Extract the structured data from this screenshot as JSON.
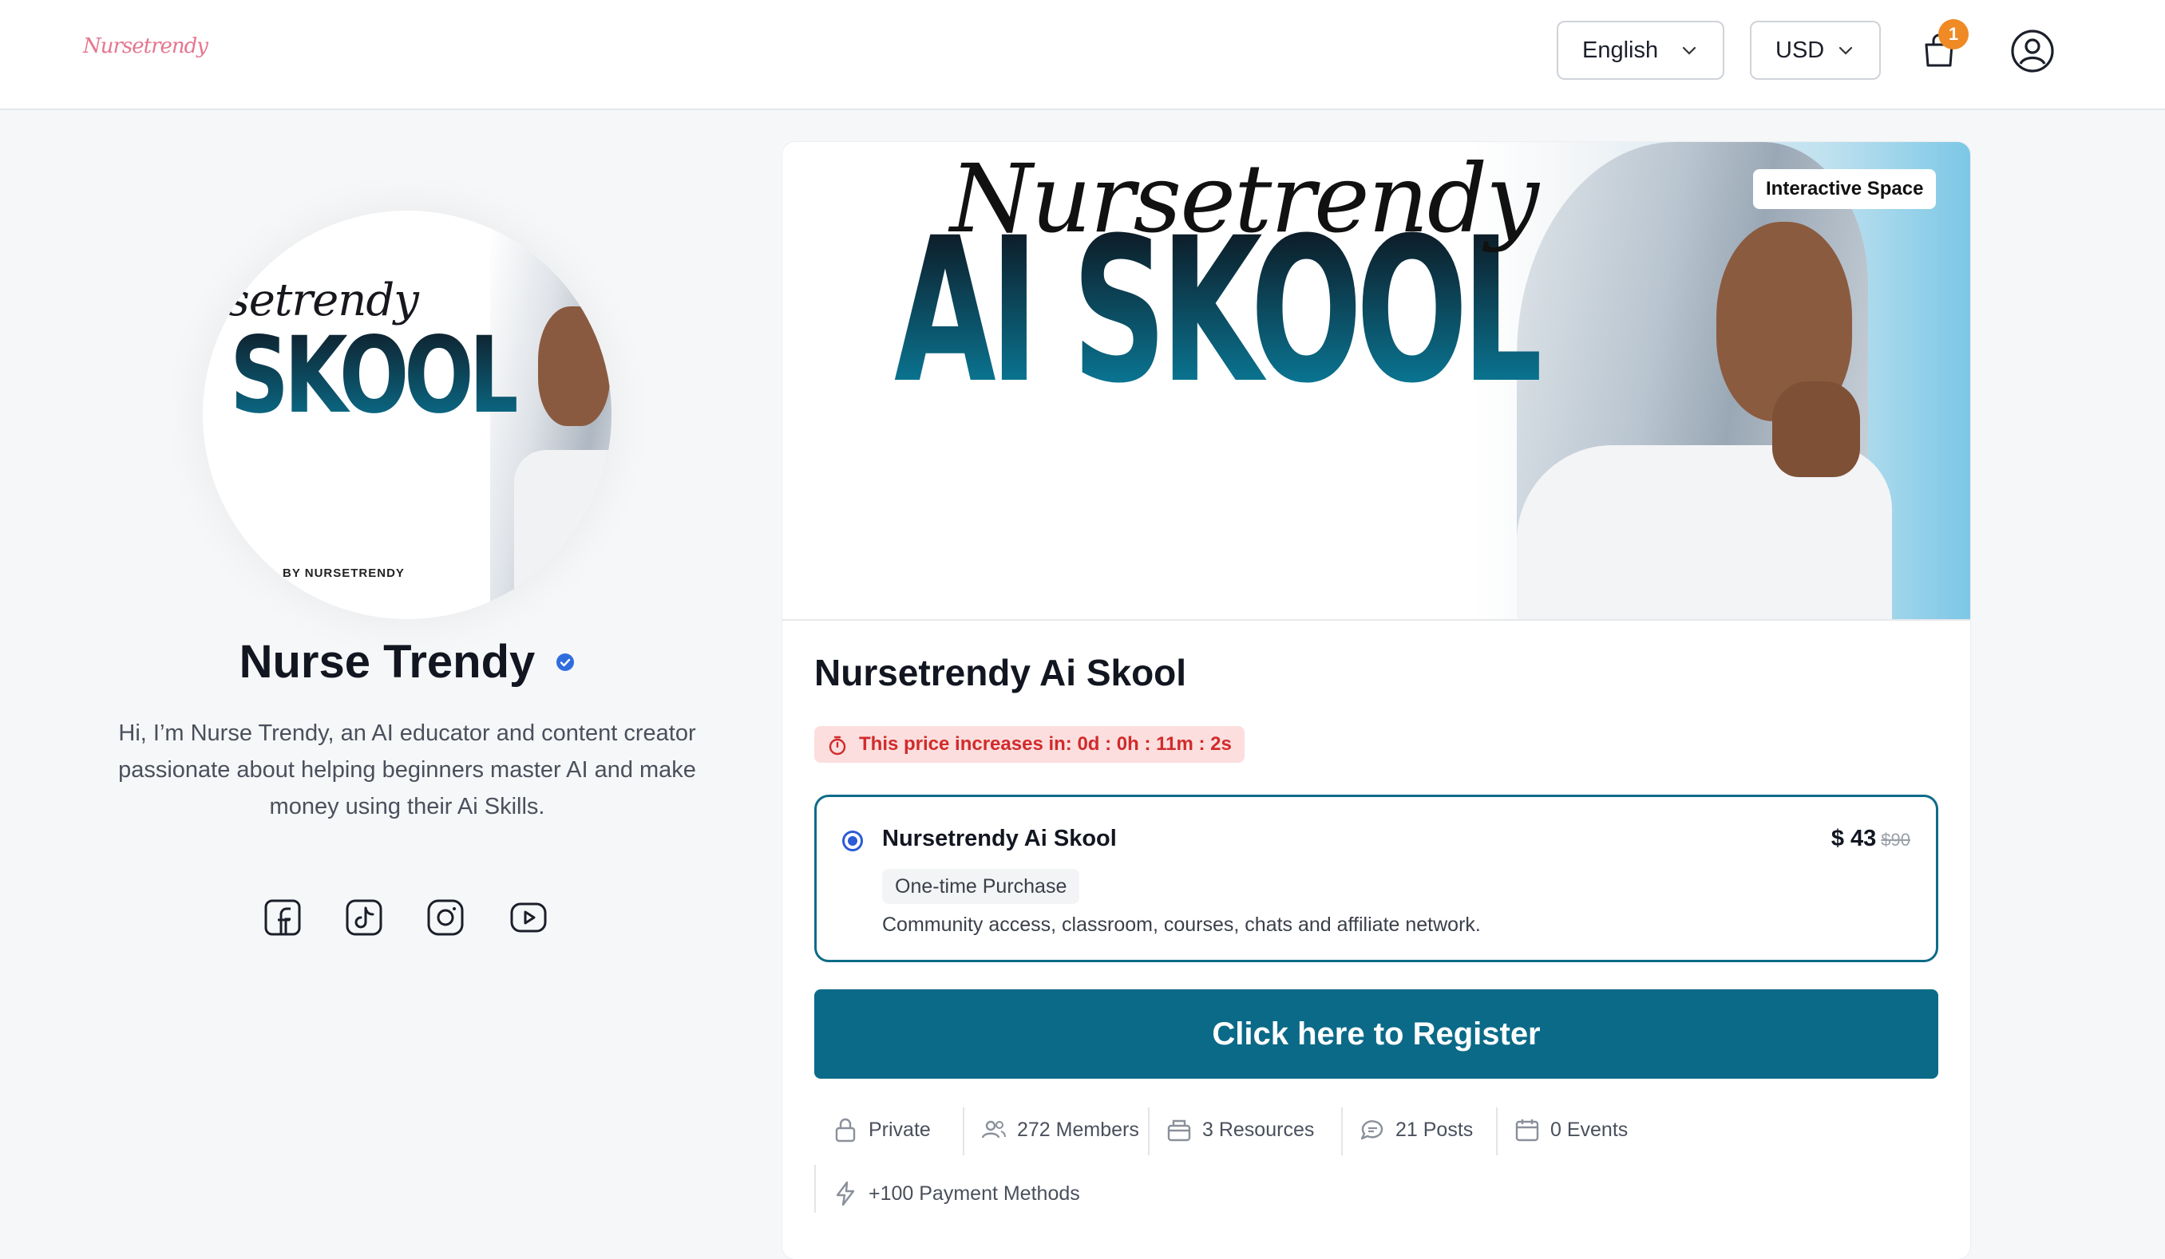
{
  "header": {
    "logo_text": "Nursetrendy",
    "language": "English",
    "currency": "USD",
    "cart_count": "1"
  },
  "profile": {
    "avatar_script": "setrendy",
    "avatar_title": "SKOOL",
    "avatar_caption": "BY NURSETRENDY",
    "name": "Nurse Trendy",
    "bio": "Hi, I’m Nurse Trendy, an AI educator and content creator passionate about helping beginners master AI and make money using their Ai Skills.",
    "socials": [
      "facebook-icon",
      "tiktok-icon",
      "instagram-icon",
      "youtube-icon"
    ]
  },
  "banner": {
    "script": "Nursetrendy",
    "title": "AI SKOOL",
    "badge": "Interactive Space"
  },
  "course": {
    "title": "Nursetrendy Ai Skool",
    "countdown": "This price increases in: 0d : 0h : 11m : 2s",
    "plan": {
      "name": "Nursetrendy Ai Skool",
      "price": "$ 43",
      "old_price": "$90",
      "type": "One-time Purchase",
      "description": "Community access, classroom, courses, chats and affiliate network."
    },
    "register_label": "Click here to Register",
    "stats": {
      "visibility": "Private",
      "members": "272 Members",
      "resources": "3 Resources",
      "posts": "21 Posts",
      "events": "0 Events",
      "payments": "+100 Payment Methods"
    }
  },
  "colors": {
    "primary": "#0b6a87",
    "countdown_bg": "#fcdede",
    "countdown_text": "#d12b2b",
    "badge_orange": "#f08a24",
    "radio_blue": "#2c5bd6"
  }
}
